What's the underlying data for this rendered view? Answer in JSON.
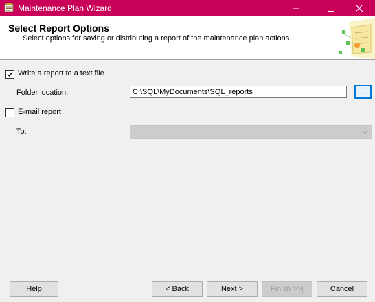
{
  "window": {
    "title": "Maintenance Plan Wizard",
    "titlebar_color": "#c9005a"
  },
  "header": {
    "title": "Select Report Options",
    "subtitle": "Select options for saving or distributing a report of the maintenance plan actions."
  },
  "options": {
    "write_report": {
      "label": "Write a report to a text file",
      "checked": true
    },
    "folder": {
      "label": "Folder location:",
      "value": "C:\\SQL\\MyDocuments\\SQL_reports",
      "browse_label": "..."
    },
    "email_report": {
      "label": "E-mail report",
      "checked": false
    },
    "to": {
      "label": "To:",
      "value": "",
      "enabled": false
    }
  },
  "buttons": {
    "help": "Help",
    "back": "< Back",
    "next": "Next >",
    "finish": "Finish >>|",
    "cancel": "Cancel"
  },
  "icons": {
    "app": "wizard-app-icon",
    "minimize": "minimize-icon",
    "maximize": "maximize-icon",
    "close": "close-icon",
    "check": "checkmark-icon",
    "dropdown": "chevron-down-icon"
  }
}
